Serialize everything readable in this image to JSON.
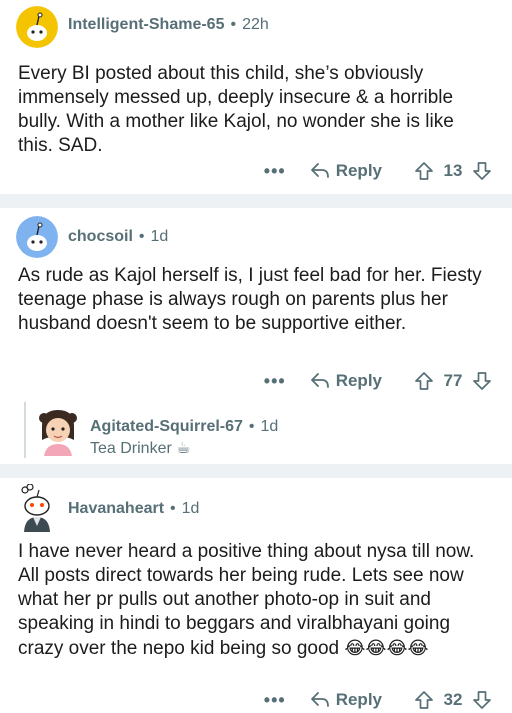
{
  "comments": [
    {
      "username": "Intelligent-Shame-65",
      "separator": "•",
      "time": "22h",
      "body": "Every BI posted about this child, she’s obviously immensely messed up, deeply insecure & a horrible bully. With a mother like Kajol, no wonder she is like this. SAD.",
      "more": "•••",
      "reply_label": "Reply",
      "votes": "13",
      "avatar_color": "#f5c400"
    },
    {
      "username": "chocsoil",
      "separator": "•",
      "time": "1d",
      "body": "As rude as Kajol herself is, I just feel bad for her. Fiesty teenage phase is always rough on parents plus her husband doesn't seem to be supportive either.",
      "more": "•••",
      "reply_label": "Reply",
      "votes": "77",
      "avatar_color": "#7fb3f0"
    },
    {
      "username": "Havanaheart",
      "separator": "•",
      "time": "1d",
      "body": "I have never heard a positive thing about nysa till now. All posts direct towards her being rude. Lets see now what her pr pulls out another photo-op in suit and speaking in hindi to beggars and viralbhayani going crazy over the nepo kid being so good",
      "emojis": "😂😂😂😂",
      "more": "•••",
      "reply_label": "Reply",
      "votes": "32"
    }
  ],
  "collapsed_reply": {
    "username": "Agitated-Squirrel-67",
    "separator": "•",
    "time": "1d",
    "flair": "Tea Drinker ☕"
  },
  "colors": {
    "meta_text": "#576f76",
    "divider": "#eef1f3",
    "thread_line": "#d3dbde"
  }
}
